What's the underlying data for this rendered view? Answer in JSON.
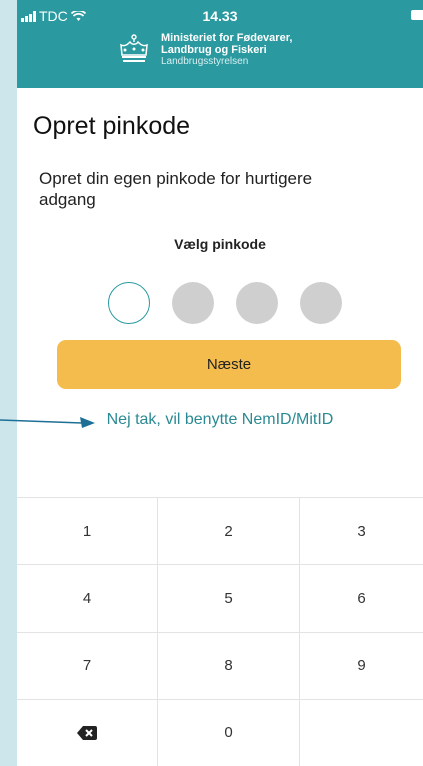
{
  "status_bar": {
    "carrier": "TDC",
    "time": "14.33"
  },
  "header": {
    "logo_icon": "crown-icon",
    "line1": "Ministeriet for Fødevarer,",
    "line2": "Landbrug og Fiskeri",
    "sub": "Landbrugsstyrelsen",
    "color": "#2a9aa0"
  },
  "page": {
    "title": "Opret pinkode",
    "subtitle": "Opret din egen pinkode for hurtigere adgang",
    "pin_label": "Vælg pinkode",
    "pin_length": 4,
    "pin_filled": 0
  },
  "actions": {
    "next_label": "Næste",
    "next_color": "#f4bc4c",
    "nemid_link": "Nej tak, vil benytte NemID/MitID"
  },
  "keypad": {
    "keys": [
      "1",
      "2",
      "3",
      "4",
      "5",
      "6",
      "7",
      "8",
      "9",
      "",
      "0",
      ""
    ],
    "delete_icon": "backspace-icon"
  },
  "annotation": {
    "arrow_color": "#1e6f96"
  }
}
